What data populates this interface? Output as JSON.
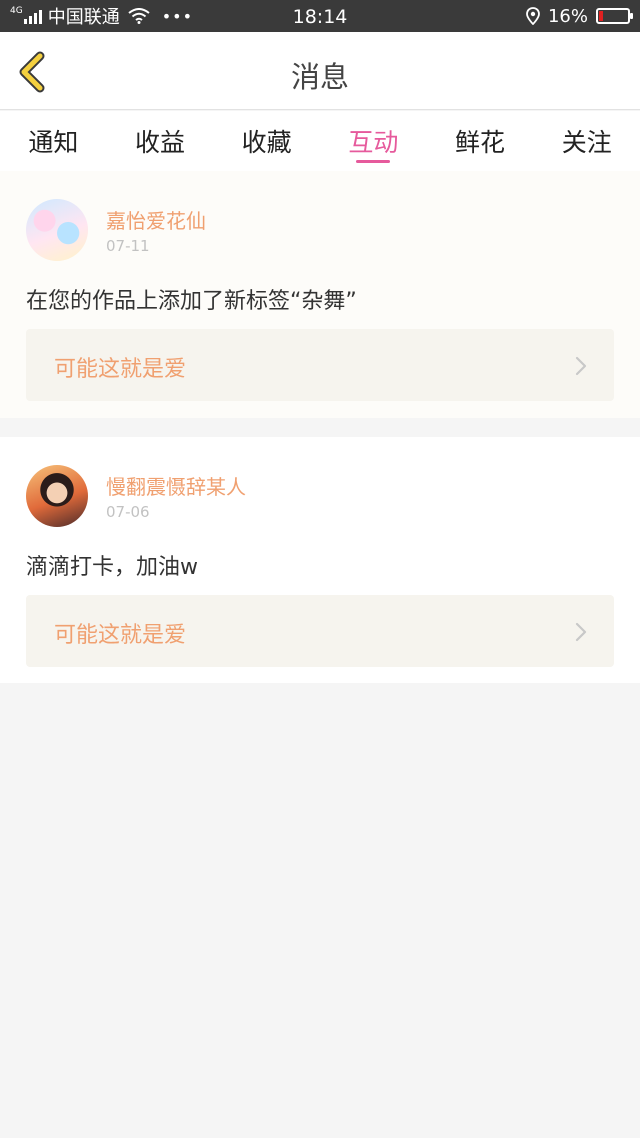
{
  "status_bar": {
    "network": "4G",
    "carrier": "中国联通",
    "time": "18:14",
    "battery": "16%",
    "battery_level": 0.16
  },
  "header": {
    "title": "消息"
  },
  "tabs": [
    {
      "label": "通知"
    },
    {
      "label": "收益"
    },
    {
      "label": "收藏"
    },
    {
      "label": "互动",
      "active": true
    },
    {
      "label": "鲜花"
    },
    {
      "label": "关注"
    }
  ],
  "items": [
    {
      "username": "嘉怡爱花仙",
      "date": "07-11",
      "message": "在您的作品上添加了新标签“杂舞”",
      "link_title": "可能这就是爱"
    },
    {
      "username": "慢翻震慑辞某人",
      "date": "07-06",
      "message": "滴滴打卡，加油w",
      "link_title": "可能这就是爱"
    }
  ],
  "colors": {
    "accent": "#e65a9c",
    "username": "#f0a070",
    "back_icon": "#f4d03f"
  }
}
